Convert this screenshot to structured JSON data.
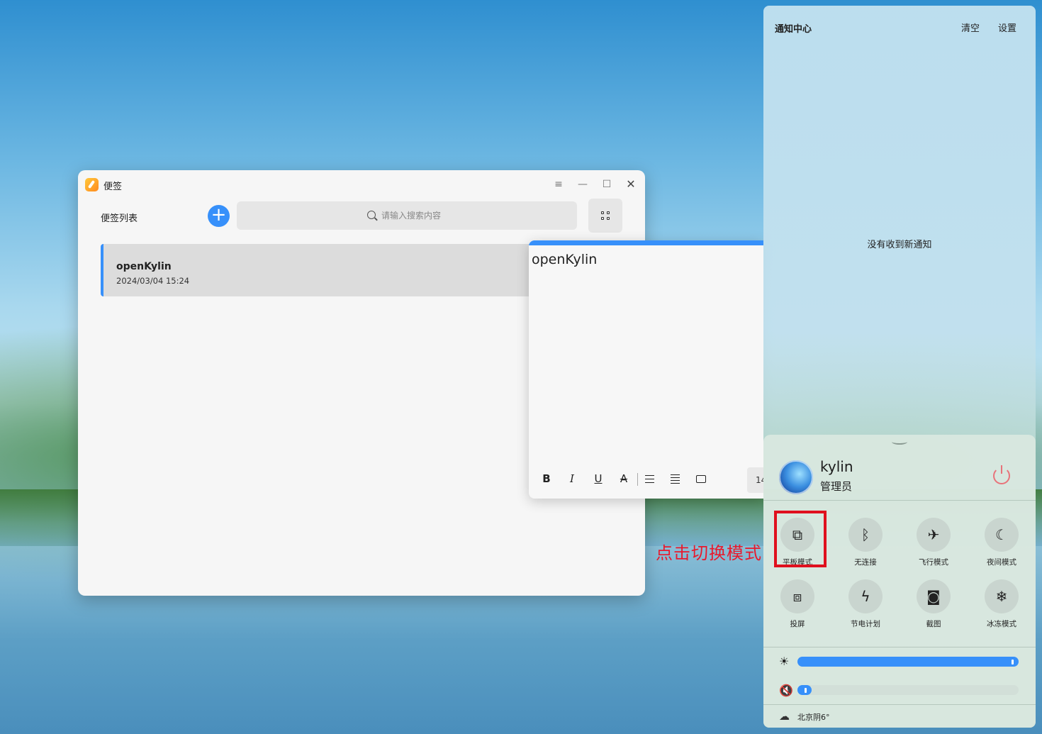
{
  "notes_app": {
    "title": "便签",
    "list_title": "便签列表",
    "add_label": "+",
    "search_placeholder": "请输入搜索内容",
    "notes": [
      {
        "title": "openKylin",
        "date": "2024/03/04  15:24"
      }
    ]
  },
  "editor": {
    "content": "openKylin",
    "toolbar": {
      "bold": "B",
      "italic": "I",
      "underline": "U",
      "strike": "A",
      "font_size": "14"
    },
    "accent": "#3790fa"
  },
  "annotation": "点击切换模式",
  "notification_center": {
    "title": "通知中心",
    "clear_label": "清空",
    "settings_label": "设置",
    "empty_message": "没有收到新通知",
    "user": {
      "name": "kylin",
      "role": "管理员"
    },
    "tiles": [
      {
        "label": "平板模式",
        "icon": "tablet-mode-icon",
        "highlighted": true
      },
      {
        "label": "无连接",
        "icon": "bluetooth-icon"
      },
      {
        "label": "飞行模式",
        "icon": "airplane-icon"
      },
      {
        "label": "夜间模式",
        "icon": "moon-icon"
      },
      {
        "label": "投屏",
        "icon": "screen-cast-icon"
      },
      {
        "label": "节电计划",
        "icon": "power-saving-icon"
      },
      {
        "label": "截图",
        "icon": "camera-icon"
      },
      {
        "label": "冰冻模式",
        "icon": "snowflake-icon"
      }
    ],
    "brightness": 100,
    "volume": 0,
    "weather": "北京阴6°",
    "highlight_color": "#e0101e"
  }
}
